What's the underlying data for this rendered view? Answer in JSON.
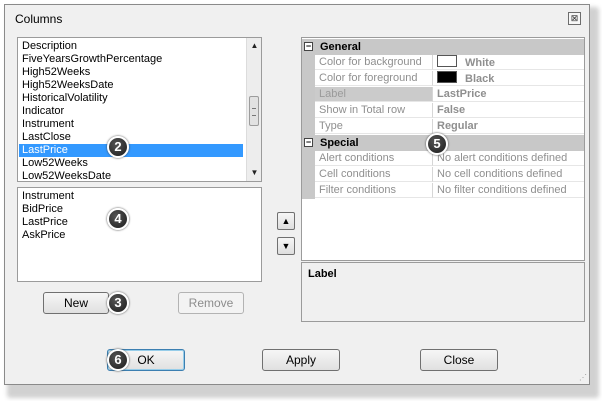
{
  "window": {
    "title": "Columns",
    "close_glyph": "⊠"
  },
  "available_columns": [
    "Description",
    "FiveYearsGrowthPercentage",
    "High52Weeks",
    "High52WeeksDate",
    "HistoricalVolatility",
    "Indicator",
    "Instrument",
    "LastClose",
    "LastPrice",
    "Low52Weeks",
    "Low52WeeksDate"
  ],
  "selected_available": "LastPrice",
  "chosen_columns": [
    "Instrument",
    "BidPrice",
    "LastPrice",
    "AskPrice"
  ],
  "buttons": {
    "new": "New",
    "remove": "Remove",
    "ok": "OK",
    "apply": "Apply",
    "close": "Close",
    "move_up": "▲",
    "move_down": "▼"
  },
  "property_grid": {
    "category_general": "General",
    "category_special": "Special",
    "expand_glyph": "−",
    "general": [
      {
        "name": "Color for background",
        "value": "White",
        "swatch": "#ffffff"
      },
      {
        "name": "Color for foreground",
        "value": "Black",
        "swatch": "#000000"
      },
      {
        "name": "Label",
        "value": "LastPrice"
      },
      {
        "name": "Show in Total row",
        "value": "False"
      },
      {
        "name": "Type",
        "value": "Regular"
      }
    ],
    "special": [
      {
        "name": "Alert conditions",
        "value": "No alert conditions defined"
      },
      {
        "name": "Cell conditions",
        "value": "No cell conditions defined"
      },
      {
        "name": "Filter conditions",
        "value": "No filter conditions defined"
      }
    ]
  },
  "description_panel": {
    "title": "Label"
  },
  "callouts": [
    "2",
    "3",
    "4",
    "5",
    "6"
  ],
  "colors": {
    "selection": "#3399ff",
    "category_bg": "#c8c8c8"
  },
  "icons": {
    "scroll_up": "chevron-up-icon",
    "scroll_down": "chevron-down-icon"
  }
}
